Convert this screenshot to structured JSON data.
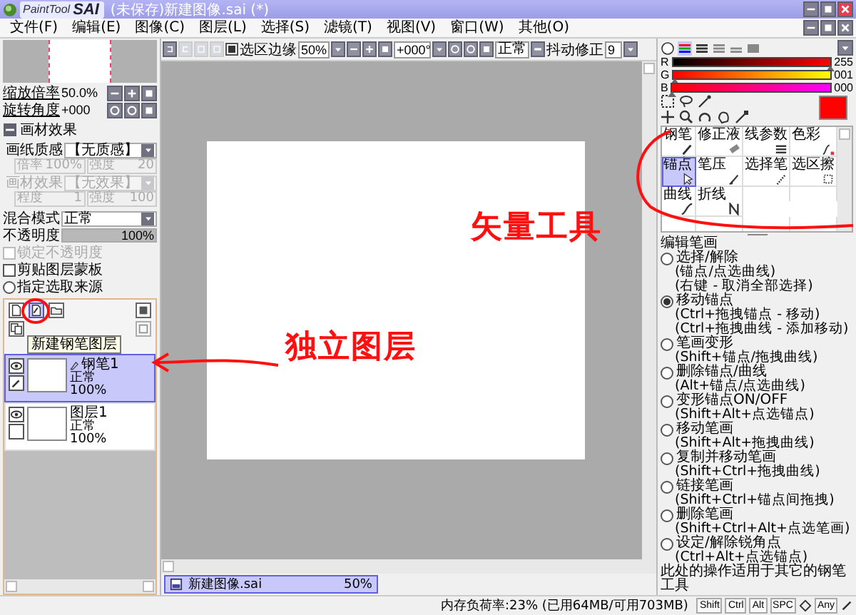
{
  "window": {
    "logo_small": "PaintTool",
    "logo_big": "SAI",
    "title": "(未保存)新建图像.sai (*)"
  },
  "menu": [
    "文件(F)",
    "编辑(E)",
    "图像(C)",
    "图层(L)",
    "选择(S)",
    "滤镜(T)",
    "视图(V)",
    "窗口(W)",
    "其他(O)"
  ],
  "navigator": {
    "zoom_label": "缩放倍率",
    "zoom": "50.0%",
    "angle_label": "旋转角度",
    "angle": "+000"
  },
  "material": {
    "title": "画材效果",
    "expanded": true,
    "fields": [
      {
        "kind": "dropdown",
        "label": "画纸质感",
        "value": "【无质感】",
        "disabled": false
      },
      {
        "kind": "pair",
        "items": [
          {
            "label": "倍率",
            "value": "100%"
          },
          {
            "label": "强度",
            "value": "20"
          }
        ],
        "disabled": true
      },
      {
        "kind": "dropdown",
        "label": "画材效果",
        "value": "【无效果】",
        "disabled": true
      },
      {
        "kind": "pair",
        "items": [
          {
            "label": "程度",
            "value": "1"
          },
          {
            "label": "强度",
            "value": "100"
          }
        ],
        "disabled": true
      }
    ]
  },
  "blend": {
    "label": "混合模式",
    "value": "正常"
  },
  "opacity": {
    "label": "不透明度",
    "value": "100%",
    "level": 1
  },
  "options": [
    {
      "kind": "checkbox",
      "label": "锁定不透明度",
      "checked": false,
      "disabled": true
    },
    {
      "kind": "checkbox",
      "label": "剪贴图层蒙板",
      "checked": false,
      "disabled": false
    },
    {
      "kind": "radio",
      "label": "指定选取来源",
      "checked": false,
      "disabled": false
    }
  ],
  "layer_tooltip": "新建钢笔图层",
  "layers": [
    {
      "kind": "pen",
      "name": "钢笔1",
      "mode": "正常",
      "opacity": "100%",
      "selected": true,
      "visible": true
    },
    {
      "kind": "raster",
      "name": "图层1",
      "mode": "正常",
      "opacity": "100%",
      "selected": false,
      "visible": true
    }
  ],
  "canvas_toolbar": {
    "selection_edge": {
      "label": "选区边缘",
      "checked": true
    },
    "zoom": "50%",
    "angle": "+000°",
    "mode_button": "正常",
    "stabilizer": {
      "label": "抖动修正",
      "value": "9"
    }
  },
  "document_tab": {
    "name": "新建图像.sai",
    "zoom": "50%"
  },
  "color": {
    "sliders": [
      {
        "channel": "R",
        "value": "255",
        "level": 1
      },
      {
        "channel": "G",
        "value": "001",
        "level": 0.004
      },
      {
        "channel": "B",
        "value": "000",
        "level": 0
      }
    ]
  },
  "tools": [
    {
      "label": "钢笔",
      "selected": false
    },
    {
      "label": "修正液",
      "selected": false
    },
    {
      "label": "线参数",
      "selected": false
    },
    {
      "label": "色彩",
      "selected": false
    },
    {
      "label": "锚点",
      "selected": true
    },
    {
      "label": "笔压",
      "selected": false
    },
    {
      "label": "选择笔",
      "selected": false
    },
    {
      "label": "选区擦",
      "selected": false
    },
    {
      "label": "曲线",
      "selected": false
    },
    {
      "label": "折线",
      "selected": false
    }
  ],
  "pen_options": {
    "title": "编辑笔画",
    "modes": [
      {
        "label": "选择/解除",
        "hints": [
          "(锚点/点选曲线)",
          "(右键 - 取消全部选择)"
        ],
        "selected": false
      },
      {
        "label": "移动锚点",
        "hints": [
          "(Ctrl+拖拽锚点 - 移动)",
          "(Ctrl+拖拽曲线 - 添加移动)"
        ],
        "selected": true
      },
      {
        "label": "笔画变形",
        "hints": [
          "(Shift+锚点/拖拽曲线)"
        ],
        "selected": false
      },
      {
        "label": "删除锚点/曲线",
        "hints": [
          "(Alt+锚点/点选曲线)"
        ],
        "selected": false
      },
      {
        "label": "变形锚点ON/OFF",
        "hints": [
          "(Shift+Alt+点选锚点)"
        ],
        "selected": false
      },
      {
        "label": "移动笔画",
        "hints": [
          "(Shift+Alt+拖拽曲线)"
        ],
        "selected": false
      },
      {
        "label": "复制并移动笔画",
        "hints": [
          "(Shift+Ctrl+拖拽曲线)"
        ],
        "selected": false
      },
      {
        "label": "链接笔画",
        "hints": [
          "(Shift+Ctrl+锚点间拖拽)"
        ],
        "selected": false
      },
      {
        "label": "删除笔画",
        "hints": [
          "(Shift+Ctrl+Alt+点选笔画)"
        ],
        "selected": false
      },
      {
        "label": "设定/解除锐角点",
        "hints": [
          "(Ctrl+Alt+点选锚点)"
        ],
        "selected": false
      }
    ],
    "note": "此处的操作适用于其它的钢笔工具"
  },
  "status": {
    "memory": "内存负荷率:23% (已用64MB/可用703MB)",
    "keys": [
      "Shift",
      "Ctrl",
      "Alt",
      "SPC",
      "Any"
    ]
  },
  "annotations": [
    "矢量工具",
    "独立图层"
  ]
}
